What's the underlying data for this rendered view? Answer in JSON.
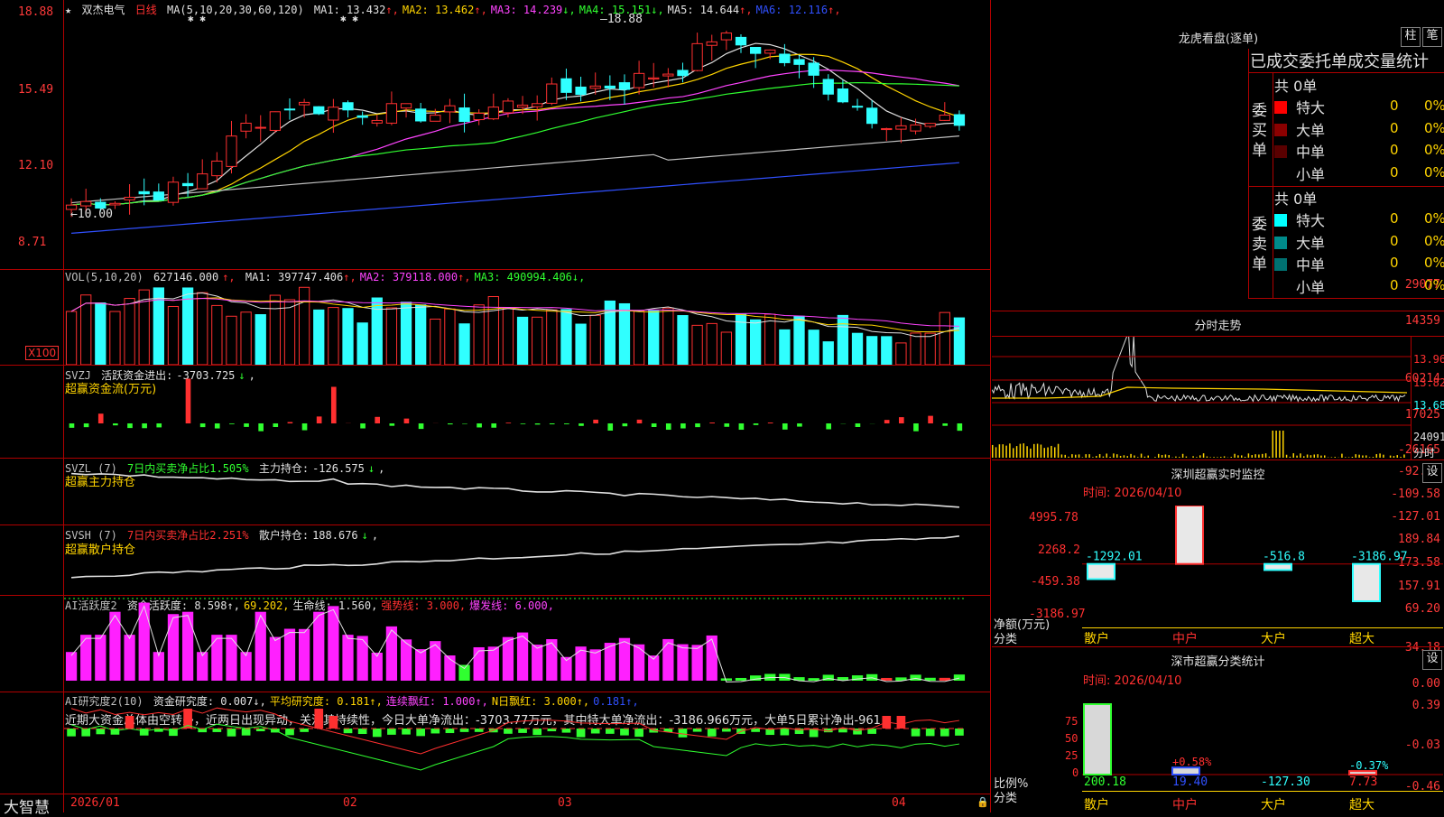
{
  "stock": {
    "name": "双杰电气",
    "period": "日线",
    "ma_params": "MA(5,10,20,30,60,120)",
    "ma": [
      {
        "label": "MA1:",
        "value": "13.432",
        "arrow": "↑",
        "color": "#e0e0e0"
      },
      {
        "label": "MA2:",
        "value": "13.462",
        "arrow": "↑",
        "color": "#ffd400"
      },
      {
        "label": "MA3:",
        "value": "14.239",
        "arrow": "↓",
        "color": "#ff44ff"
      },
      {
        "label": "MA4:",
        "value": "15.151",
        "arrow": "↓",
        "color": "#30ff30"
      },
      {
        "label": "MA5:",
        "value": "14.644",
        "arrow": "↑",
        "color": "#e0e0e0"
      },
      {
        "label": "MA6:",
        "value": "12.116",
        "arrow": "↑",
        "color": "#3050ff"
      }
    ],
    "price_axis": [
      "18.88",
      "15.49",
      "12.10",
      "8.71"
    ],
    "high_mark": "18.88",
    "low_mark": "10.00"
  },
  "vol": {
    "header": "VOL(5,10,20)",
    "value": "627146.000",
    "ma": [
      {
        "label": "MA1:",
        "value": "397747.406",
        "arrow": "↑",
        "color": "#e0e0e0"
      },
      {
        "label": "MA2:",
        "value": "379118.000",
        "arrow": "↑",
        "color": "#ff44ff"
      },
      {
        "label": "MA3:",
        "value": "490994.406",
        "arrow": "↓",
        "color": "#30ff30"
      }
    ],
    "axis": [
      "29077",
      "14359"
    ],
    "unit": "X100"
  },
  "svzj": {
    "header": "SVZJ",
    "label": "活跃资金进出:",
    "value": "-3703.725",
    "arrow": "↓",
    "subtitle": "超赢资金流(万元)",
    "axis": [
      "60214",
      "17025",
      "-26165"
    ]
  },
  "svzl": {
    "header": "SVZL (7)",
    "pct_label": "7日内买卖净占比1.505%",
    "label": "主力持仓:",
    "value": "-126.575",
    "arrow": "↓",
    "subtitle": "超赢主力持仓",
    "axis": [
      "-92.16",
      "-109.58",
      "-127.01"
    ]
  },
  "svsh": {
    "header": "SVSH (7)",
    "pct_label": "7日内买卖净占比2.251%",
    "label": "散户持仓:",
    "value": "188.676",
    "arrow": "↓",
    "subtitle": "超赢散户持仓",
    "axis": [
      "189.84",
      "173.58",
      "157.91"
    ]
  },
  "ai_active": {
    "header": "AI活跃度2",
    "items": [
      {
        "text": "资金活跃度: 8.598",
        "arrow": "↑",
        "color": "#e0e0e0"
      },
      {
        "text": "69.202",
        "arrow": "",
        "color": "#ffd400"
      },
      {
        "text": "生命线: 1.560",
        "arrow": "",
        "color": "#e0e0e0"
      },
      {
        "text": "强势线: 3.000",
        "arrow": "",
        "color": "#ff3030"
      },
      {
        "text": "爆发线: 6.000",
        "arrow": "",
        "color": "#ff44ff"
      }
    ],
    "axis": [
      "69.20",
      "34.18",
      "0.00"
    ]
  },
  "ai_research": {
    "header": "AI研究度2(10)",
    "items": [
      {
        "text": "资金研究度: 0.007",
        "arrow": "↓",
        "color": "#e0e0e0"
      },
      {
        "text": "平均研究度: 0.181",
        "arrow": "↑",
        "color": "#ffd400"
      },
      {
        "text": "连续飘红: 1.000",
        "arrow": "↑",
        "color": "#ff44ff"
      },
      {
        "text": "N日飘红: 3.000",
        "arrow": "↑",
        "color": "#ffd400"
      },
      {
        "text": "0.181",
        "arrow": "↑",
        "color": "#3050ff"
      }
    ],
    "comment": "近期大资金总体由空转多，近两日出现异动，关注其持续性，今日大单净流出：-3703.77万元，其中特大单净流出：-3186.966万元，大单5日累计净出-961",
    "axis": [
      "0.39",
      "-0.03",
      "-0.46"
    ]
  },
  "x_axis": [
    "2026/01",
    "02",
    "03",
    "04"
  ],
  "brand": "大智慧",
  "dragon_tiger": {
    "title": "龙虎看盘(逐单)",
    "btn_bar": "柱",
    "btn_pen": "笔",
    "tabs": "已成交委托单成交量统计",
    "buy": {
      "side": "委买单",
      "total": "共 0单",
      "rows": [
        {
          "name": "特大",
          "count": "0",
          "pct": "0%",
          "color": "#ff0000"
        },
        {
          "name": "大单",
          "count": "0",
          "pct": "0%",
          "color": "#8b0000"
        },
        {
          "name": "中单",
          "count": "0",
          "pct": "0%",
          "color": "#5a0000"
        },
        {
          "name": "小单",
          "count": "0",
          "pct": "0%",
          "color": "#000000"
        }
      ]
    },
    "sell": {
      "side": "委卖单",
      "total": "共 0单",
      "rows": [
        {
          "name": "特大",
          "count": "0",
          "pct": "0%",
          "color": "#00ffff"
        },
        {
          "name": "大单",
          "count": "0",
          "pct": "0%",
          "color": "#008b8b"
        },
        {
          "name": "中单",
          "count": "0",
          "pct": "0%",
          "color": "#007070"
        },
        {
          "name": "小单",
          "count": "0",
          "pct": "0%",
          "color": "#000000"
        }
      ]
    }
  },
  "intraday": {
    "title": "分时走势",
    "axis": [
      "13.96",
      "13.82",
      "13.68"
    ],
    "vol_label": "24091",
    "vol_unit": "分时"
  },
  "monitor": {
    "title": "深圳超赢实时监控",
    "settings": "设",
    "time": "时间: 2026/04/10",
    "axis": [
      "4995.78",
      "2268.2",
      "-459.38",
      "-3186.97"
    ],
    "y_label": "净额(万元)",
    "x_label": "分类",
    "categories": [
      "散户",
      "中户",
      "大户",
      "超大"
    ],
    "values": [
      -1292.01,
      4995.78,
      -516.8,
      -3186.97
    ],
    "value_labels": [
      "-1292.01",
      "4995.78",
      "-516.8",
      "-3186.97"
    ]
  },
  "classify": {
    "title": "深市超赢分类统计",
    "settings": "设",
    "time": "时间: 2026/04/10",
    "axis": [
      "75",
      "50",
      "25",
      "0"
    ],
    "y_label": "比例%",
    "x_label": "分类",
    "categories": [
      "散户",
      "中户",
      "大户",
      "超大"
    ],
    "pcts": [
      "",
      "+0.58%",
      "",
      "-0.37%"
    ],
    "bottom_values": [
      "200.18",
      "19.40",
      "-127.30",
      "7.73"
    ],
    "ratios": [
      100,
      10,
      0,
      5
    ]
  },
  "colors": {
    "up": "#ff3030",
    "down": "#30ffff",
    "frame": "#b00000"
  }
}
